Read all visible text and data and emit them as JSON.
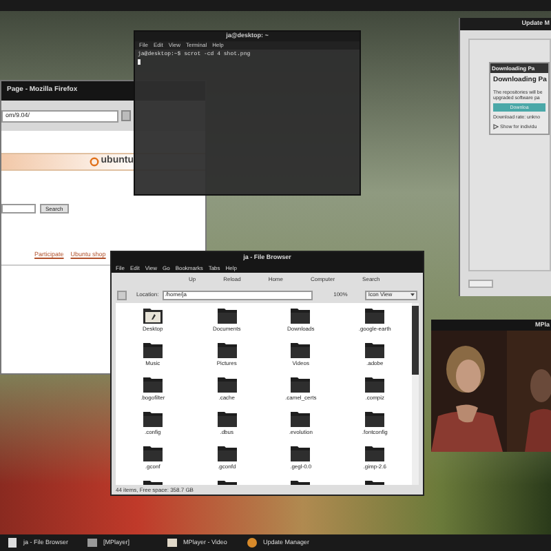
{
  "firefox": {
    "title": "Page - Mozilla Firefox",
    "url": "om/9.04/",
    "logo": "ubuntu",
    "search_button": "Search",
    "links": [
      "Participate",
      "Ubuntu shop"
    ]
  },
  "terminal": {
    "title": "ja@desktop: ~",
    "menu": [
      "File",
      "Edit",
      "View",
      "Terminal",
      "Help"
    ],
    "lines": [
      "ja@desktop:~$ scrot -cd 4 shot.png"
    ]
  },
  "file_browser": {
    "title": "ja - File Browser",
    "menu": [
      "File",
      "Edit",
      "View",
      "Go",
      "Bookmarks",
      "Tabs",
      "Help"
    ],
    "toolbar": [
      "Up",
      "Reload",
      "Home",
      "Computer",
      "Search"
    ],
    "location_label": "Location:",
    "location": "/home/ja",
    "zoom": "100%",
    "view": "Icon View",
    "items": [
      {
        "name": "Desktop",
        "kind": "desktop"
      },
      {
        "name": "Documents",
        "kind": "folder"
      },
      {
        "name": "Downloads",
        "kind": "folder"
      },
      {
        "name": ".google-earth",
        "kind": "folder"
      },
      {
        "name": "Music",
        "kind": "folder"
      },
      {
        "name": "Pictures",
        "kind": "folder"
      },
      {
        "name": "Videos",
        "kind": "folder"
      },
      {
        "name": ".adobe",
        "kind": "folder"
      },
      {
        "name": ".bogofilter",
        "kind": "folder"
      },
      {
        "name": ".cache",
        "kind": "folder"
      },
      {
        "name": ".camel_certs",
        "kind": "folder"
      },
      {
        "name": ".compiz",
        "kind": "folder"
      },
      {
        "name": ".config",
        "kind": "folder"
      },
      {
        "name": ".dbus",
        "kind": "folder"
      },
      {
        "name": ".evolution",
        "kind": "folder"
      },
      {
        "name": ".fontconfig",
        "kind": "folder"
      },
      {
        "name": ".gconf",
        "kind": "folder"
      },
      {
        "name": ".gconfd",
        "kind": "folder"
      },
      {
        "name": ".gegl-0.0",
        "kind": "folder"
      },
      {
        "name": ".gimp-2.6",
        "kind": "folder"
      }
    ],
    "status": "44 items, Free space: 358.7 GB"
  },
  "update_manager": {
    "title": "Update M",
    "dialog": {
      "title": "Downloading Pa",
      "heading": "Downloading Pa",
      "text": "The repositories will be upgraded software pa",
      "progress": {
        "level": 1,
        "label": "Downloa"
      },
      "rate": "Download rate: unkno",
      "details": "Show for individu"
    }
  },
  "mplayer": {
    "title": "MPla"
  },
  "taskbar": [
    {
      "label": "ja - File Browser",
      "kind": "files"
    },
    {
      "label": "[MPlayer]",
      "kind": "player"
    },
    {
      "label": "MPlayer - Video",
      "kind": "video"
    },
    {
      "label": "Update Manager",
      "kind": "update"
    }
  ]
}
